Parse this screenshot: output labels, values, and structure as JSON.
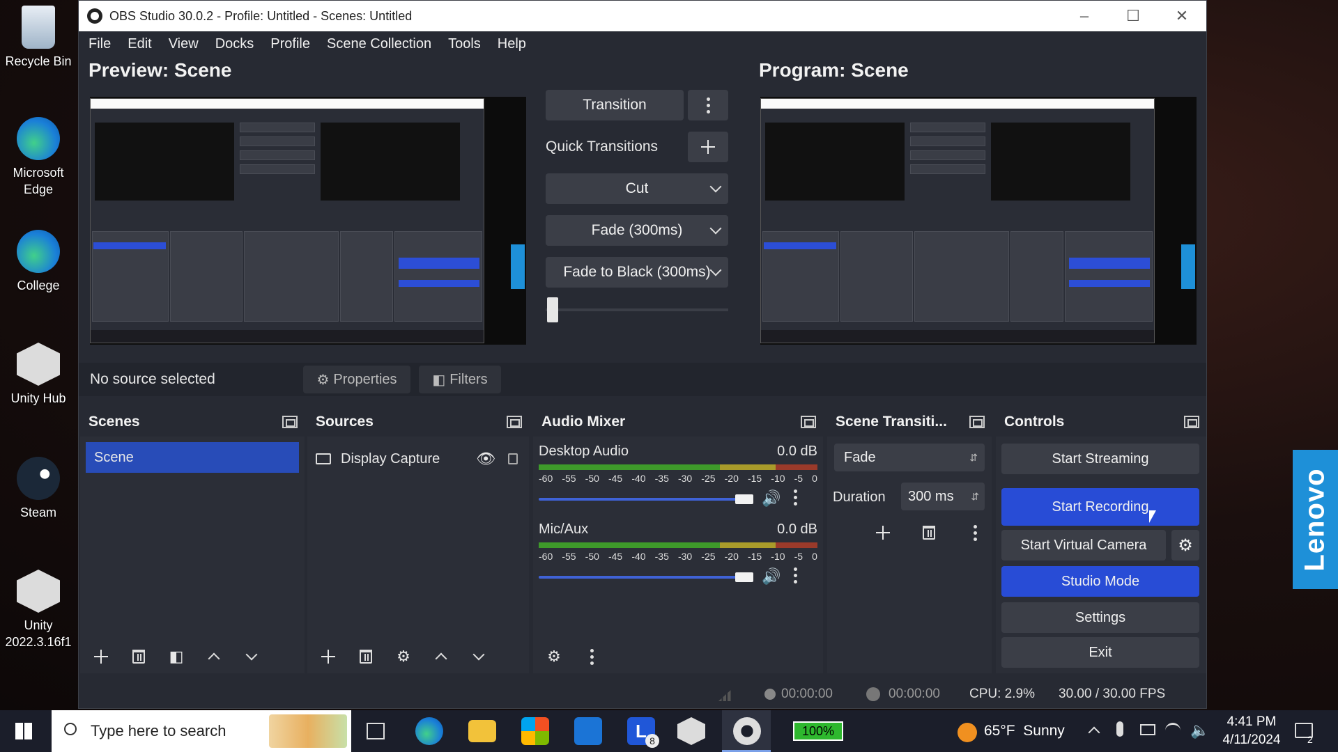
{
  "desktop": {
    "icons": [
      {
        "label": "Recycle Bin"
      },
      {
        "label": "Microsoft Edge"
      },
      {
        "label": "College"
      },
      {
        "label": "Unity Hub"
      },
      {
        "label": "Steam"
      },
      {
        "label": "Unity 2022.3.16f1"
      }
    ],
    "lenovo_tab": "Lenovo"
  },
  "window": {
    "title": "OBS Studio 30.0.2 - Profile: Untitled - Scenes: Untitled",
    "menu": [
      "File",
      "Edit",
      "View",
      "Docks",
      "Profile",
      "Scene Collection",
      "Tools",
      "Help"
    ]
  },
  "preview": {
    "preview_title": "Preview: Scene",
    "program_title": "Program: Scene"
  },
  "transitions": {
    "transition_label": "Transition",
    "quick_transitions_label": "Quick Transitions",
    "quick": [
      "Cut",
      "Fade (300ms)",
      "Fade to Black (300ms)"
    ],
    "t_bar_value": 0
  },
  "source_toolbar": {
    "no_source": "No source selected",
    "properties": "Properties",
    "filters": "Filters"
  },
  "docks": {
    "scenes": {
      "title": "Scenes",
      "items": [
        "Scene"
      ]
    },
    "sources": {
      "title": "Sources",
      "items": [
        "Display Capture"
      ]
    },
    "audio_mixer": {
      "title": "Audio Mixer",
      "channels": [
        {
          "name": "Desktop Audio",
          "level": "0.0 dB",
          "volume": 1.0
        },
        {
          "name": "Mic/Aux",
          "level": "0.0 dB",
          "volume": 1.0
        }
      ],
      "scale": [
        "-60",
        "-55",
        "-50",
        "-45",
        "-40",
        "-35",
        "-30",
        "-25",
        "-20",
        "-15",
        "-10",
        "-5",
        "0"
      ]
    },
    "scene_transitions": {
      "title": "Scene Transiti...",
      "selected": "Fade",
      "duration_label": "Duration",
      "duration_value": "300 ms"
    },
    "controls": {
      "title": "Controls",
      "start_streaming": "Start Streaming",
      "start_recording": "Start Recording",
      "start_virtual_camera": "Start Virtual Camera",
      "studio_mode": "Studio Mode",
      "settings": "Settings",
      "exit": "Exit"
    }
  },
  "status": {
    "stream_time": "00:00:00",
    "rec_time": "00:00:00",
    "cpu": "CPU: 2.9%",
    "fps": "30.00 / 30.00 FPS"
  },
  "taskbar": {
    "search_placeholder": "Type here to search",
    "battery": "100%",
    "weather": "65°F  Sunny",
    "time": "4:41 PM",
    "date": "4/11/2024",
    "badge_l": "8",
    "notif_count": "2"
  },
  "colors": {
    "accent_blue": "#284cd6",
    "obs_bg": "#272a33",
    "lenovo": "#1e90d8"
  }
}
